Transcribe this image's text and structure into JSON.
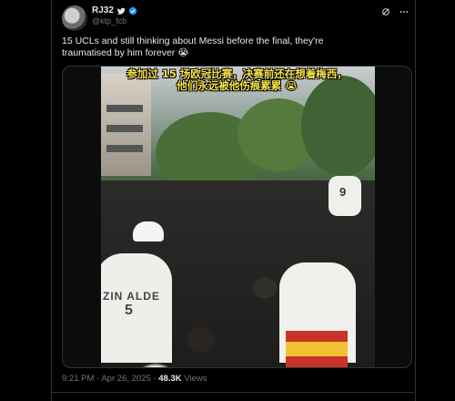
{
  "tweet": {
    "display_name": "RJ32",
    "handle": "@ktp_fcb",
    "text": "15 UCLs and still thinking about Messi before the final, they're traumatised by him forever 😭",
    "media": {
      "subtitle_line1": "参加过 15 场欧冠比赛，决赛前还在想着梅西，",
      "subtitle_line2": "他们永远被他伤痕累累 😭",
      "jersey_text_left": "ZIN ALDE",
      "jersey_number_left": "5",
      "jersey_number_right": "9"
    },
    "time": "9:21 PM",
    "date": "Apr 26, 2025",
    "dot": "·",
    "views_count": "48.3K",
    "views_label": "Views"
  },
  "icons": {
    "verified": "verified-badge-icon",
    "grok": "grok-icon",
    "more": "more-icon"
  },
  "colors": {
    "background": "#000000",
    "verified_blue": "#1d9bf0",
    "subtitle_yellow": "#f6e24a",
    "muted_text": "#71767b"
  }
}
